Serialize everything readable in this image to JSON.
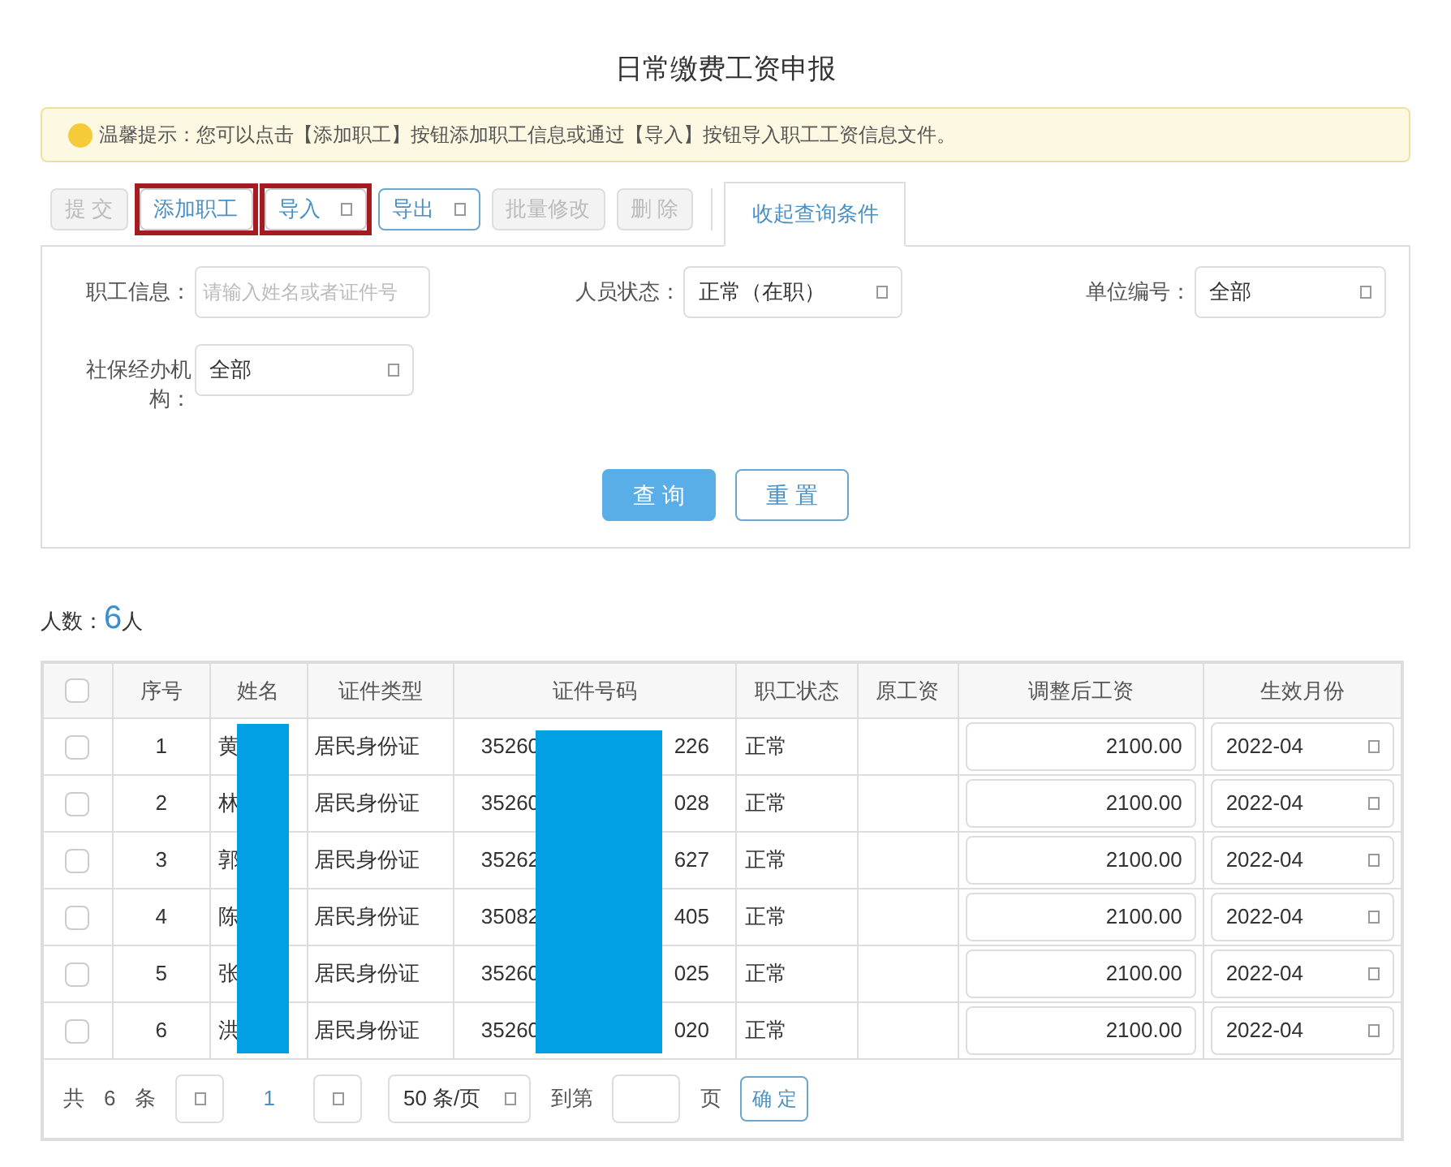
{
  "title": "日常缴费工资申报",
  "notice": {
    "text": "温馨提示：您可以点击【添加职工】按钮添加职工信息或通过【导入】按钮导入职工工资信息文件。"
  },
  "toolbar": [
    {
      "label": "提 交",
      "kind": "plain",
      "disabled": true,
      "highlighted": false
    },
    {
      "label": "添加职工",
      "kind": "plain",
      "disabled": false,
      "highlighted": true
    },
    {
      "label": "导入",
      "kind": "dropdown",
      "disabled": false,
      "highlighted": true
    },
    {
      "label": "导出",
      "kind": "dropdown",
      "disabled": false,
      "highlighted": false
    },
    {
      "label": "批量修改",
      "kind": "plain",
      "disabled": true,
      "highlighted": false
    },
    {
      "label": "删 除",
      "kind": "plain",
      "disabled": true,
      "highlighted": false
    }
  ],
  "filter_tab": "收起查询条件",
  "filters": [
    {
      "label": "职工信息：",
      "kind": "input",
      "placeholder": "请输入姓名或者证件号"
    },
    {
      "label": "人员状态：",
      "kind": "select",
      "value": "正常（在职）"
    },
    {
      "label": "单位编号：",
      "kind": "select",
      "value": "全部"
    },
    {
      "label": "社保经办机构：",
      "kind": "select",
      "value": "全部"
    }
  ],
  "actions": {
    "query": "查 询",
    "reset": "重 置"
  },
  "count": {
    "label": "人数：",
    "value": "6",
    "unit": "人"
  },
  "table": {
    "columns": [
      "序号",
      "姓名",
      "证件类型",
      "证件号码",
      "职工状态",
      "原工资",
      "调整后工资",
      "生效月份"
    ],
    "header_checked": false,
    "rows": [
      {
        "checked": false,
        "index": "1",
        "name": "黄",
        "id_type": "居民身份证",
        "id_start": "35260",
        "id_end": "226",
        "status": "正常",
        "salary": "2100.00",
        "month": "2022-04"
      },
      {
        "checked": false,
        "index": "2",
        "name": "林",
        "id_type": "居民身份证",
        "id_start": "35260",
        "id_end": "028",
        "status": "正常",
        "salary": "2100.00",
        "month": "2022-04"
      },
      {
        "checked": false,
        "index": "3",
        "name": "郭",
        "id_type": "居民身份证",
        "id_start": "35262",
        "id_end": "627",
        "status": "正常",
        "salary": "2100.00",
        "month": "2022-04"
      },
      {
        "checked": false,
        "index": "4",
        "name": "陈",
        "id_type": "居民身份证",
        "id_start": "35082",
        "id_end": "405",
        "status": "正常",
        "salary": "2100.00",
        "month": "2022-04"
      },
      {
        "checked": false,
        "index": "5",
        "name": "张",
        "id_type": "居民身份证",
        "id_start": "35260",
        "id_end": "025",
        "status": "正常",
        "salary": "2100.00",
        "month": "2022-04"
      },
      {
        "checked": false,
        "index": "6",
        "name": "洪",
        "id_type": "居民身份证",
        "id_start": "35260",
        "id_end": "020",
        "status": "正常",
        "salary": "2100.00",
        "month": "2022-04"
      }
    ]
  },
  "pagination": {
    "total_prefix": "共",
    "total": "6",
    "total_suffix": "条",
    "page": "1",
    "page_size": "50 条/页",
    "goto_label": "到第",
    "goto_suffix": "页",
    "confirm": "确 定"
  }
}
